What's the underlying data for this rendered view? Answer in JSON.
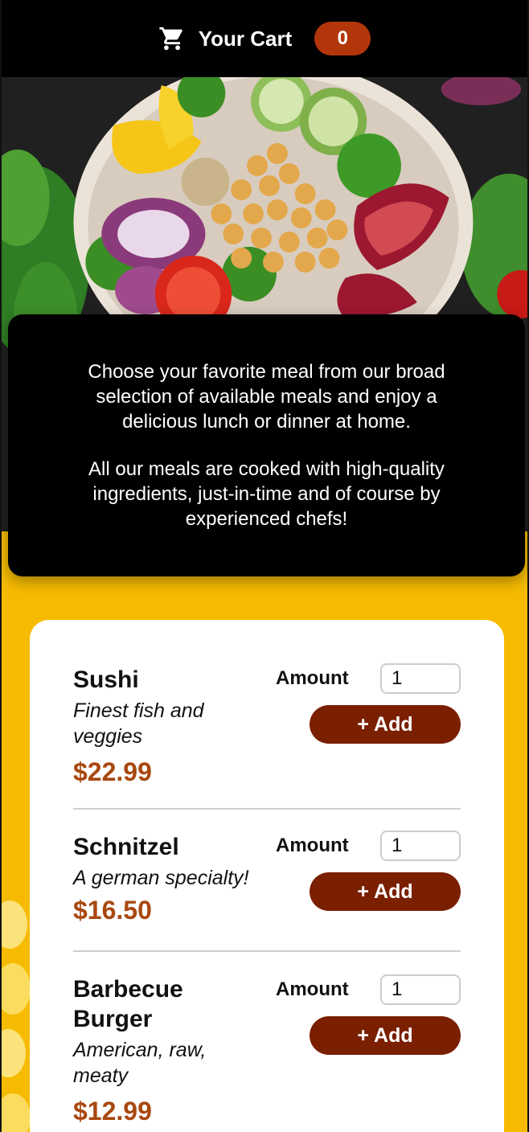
{
  "header": {
    "cart_icon": "cart-icon",
    "cart_label": "Your Cart",
    "cart_count": "0"
  },
  "summary": {
    "paragraph_1": "Choose your favorite meal from our broad selection of available meals and enjoy a delicious lunch or dinner at home.",
    "paragraph_2": "All our meals are cooked with high-quality ingredients, just-in-time and of course by experienced chefs!"
  },
  "meals": [
    {
      "name": "Sushi",
      "description": "Finest fish and veggies",
      "price": "$22.99",
      "amount_label": "Amount",
      "amount_value": "1",
      "add_label": "+ Add"
    },
    {
      "name": "Schnitzel",
      "description": "A german specialty!",
      "price": "$16.50",
      "amount_label": "Amount",
      "amount_value": "1",
      "add_label": "+ Add"
    },
    {
      "name": "Barbecue Burger",
      "description": "American, raw, meaty",
      "price": "$12.99",
      "amount_label": "Amount",
      "amount_value": "1",
      "add_label": "+ Add"
    }
  ],
  "colors": {
    "header_bg": "#000000",
    "badge_bg": "#b3360b",
    "page_bg": "#f6bb00",
    "price": "#a8480f",
    "add_button": "#7a1f00"
  }
}
